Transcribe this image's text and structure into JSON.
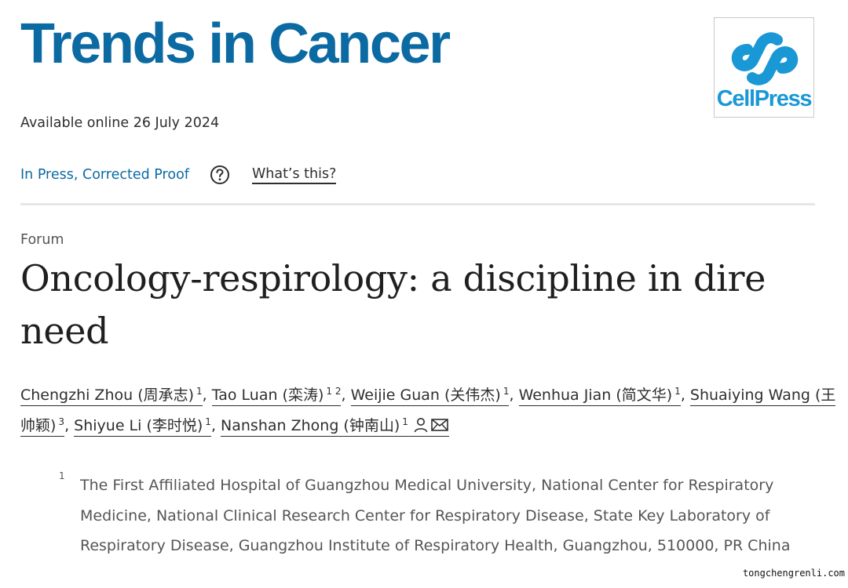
{
  "journal": {
    "title": "Trends in Cancer",
    "brand_color": "#0c6aa3"
  },
  "publisher_logo": {
    "text": "CellPress",
    "icon": "cellpress-logo-icon",
    "color": "#1a98d5"
  },
  "availability": "Available online 26 July 2024",
  "status": {
    "label": "In Press, Corrected Proof",
    "help_icon": "question-circle-icon",
    "help_link": "What’s this?"
  },
  "article": {
    "type": "Forum",
    "title": "Oncology-respirology: a discipline in dire need"
  },
  "authors": [
    {
      "name": "Chengzhi Zhou (周承志)",
      "refs": "1"
    },
    {
      "name": "Tao Luan (栾涛)",
      "refs": "1 2"
    },
    {
      "name": "Weijie Guan (关伟杰)",
      "refs": "1"
    },
    {
      "name": "Wenhua Jian (简文华)",
      "refs": "1"
    },
    {
      "name": "Shuaiying Wang (王帅颖)",
      "refs": "3"
    },
    {
      "name": "Shiyue Li (李时悦)",
      "refs": "1"
    },
    {
      "name": "Nanshan Zhong (钟南山)",
      "refs": "1",
      "icons": [
        "person-icon",
        "envelope-icon"
      ]
    }
  ],
  "affiliations": [
    {
      "marker": "1",
      "text": "The First Affiliated Hospital of Guangzhou Medical University, National Center for Respiratory Medicine, National Clinical Research Center for Respiratory Disease, State Key Laboratory of Respiratory Disease, Guangzhou Institute of Respiratory Health, Guangzhou, 510000, PR China"
    }
  ],
  "watermark": "tongchengrenli.com"
}
